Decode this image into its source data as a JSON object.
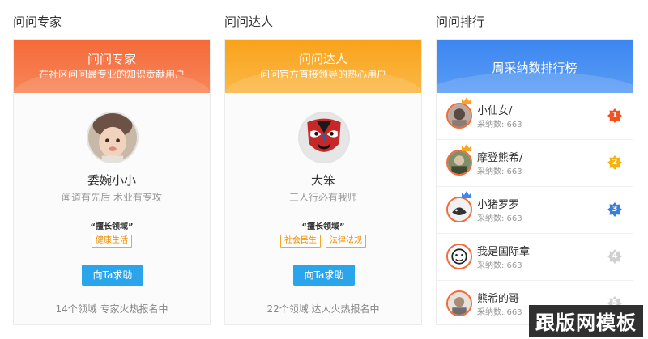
{
  "experts": {
    "section_title": "问问专家",
    "banner_title": "问问专家",
    "banner_sub": "在社区问问最专业的知识贡献用户",
    "name": "委婉小小",
    "motto": "闻道有先后 术业有专攻",
    "field_label": "“擅长领域”",
    "tags": [
      "健康生活"
    ],
    "button": "向Ta求助",
    "footer": "14个领域 专家火热报名中"
  },
  "talents": {
    "section_title": "问问达人",
    "banner_title": "问问达人",
    "banner_sub": "问问官方直接领导的热心用户",
    "name": "大笨",
    "motto": "三人行必有我师",
    "field_label": "“擅长领域”",
    "tags": [
      "社会民生",
      "法律法规"
    ],
    "button": "向Ta求助",
    "footer": "22个领域 达人火热报名中"
  },
  "ranking": {
    "section_title": "问问排行",
    "banner_title": "周采纳数排行榜",
    "items": [
      {
        "name": "小仙女/",
        "count": "采纳数: 663",
        "rank": "1",
        "badge_color": "#f4511e",
        "crown_color": "#f6a623"
      },
      {
        "name": "摩登熊希/",
        "count": "采纳数: 663",
        "rank": "2",
        "badge_color": "#f6b20e",
        "crown_color": "#f6a623"
      },
      {
        "name": "小猪罗罗",
        "count": "采纳数: 663",
        "rank": "3",
        "badge_color": "#3b7ddd",
        "crown_color": "#3b86f0"
      },
      {
        "name": "我是国际章",
        "count": "采纳数: 663",
        "rank": "4",
        "badge_color": "#d0d0d0",
        "crown_color": ""
      },
      {
        "name": "熊希的哥",
        "count": "采纳数: 663",
        "rank": "5",
        "badge_color": "#d0d0d0",
        "crown_color": ""
      }
    ]
  },
  "watermark": "跟版网模板"
}
